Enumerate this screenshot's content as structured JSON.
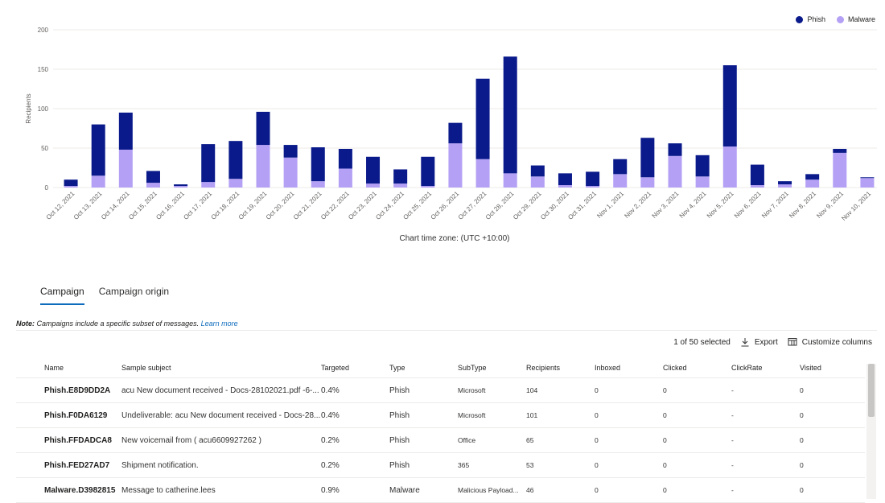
{
  "chart_data": {
    "type": "bar",
    "stacked": true,
    "categories": [
      "Oct 12, 2021",
      "Oct 13, 2021",
      "Oct 14, 2021",
      "Oct 15, 2021",
      "Oct 16, 2021",
      "Oct 17, 2021",
      "Oct 18, 2021",
      "Oct 19, 2021",
      "Oct 20, 2021",
      "Oct 21, 2021",
      "Oct 22, 2021",
      "Oct 23, 2021",
      "Oct 24, 2021",
      "Oct 25, 2021",
      "Oct 26, 2021",
      "Oct 27, 2021",
      "Oct 28, 2021",
      "Oct 29, 2021",
      "Oct 30, 2021",
      "Oct 31, 2021",
      "Nov 1, 2021",
      "Nov 2, 2021",
      "Nov 3, 2021",
      "Nov 4, 2021",
      "Nov 5, 2021",
      "Nov 6, 2021",
      "Nov 7, 2021",
      "Nov 8, 2021",
      "Nov 9, 2021",
      "Nov 10, 2021"
    ],
    "series": [
      {
        "name": "Malware",
        "color": "#b4a0f5",
        "values": [
          2,
          15,
          48,
          6,
          2,
          7,
          11,
          54,
          38,
          8,
          24,
          5,
          5,
          2,
          56,
          36,
          18,
          14,
          3,
          2,
          17,
          13,
          40,
          14,
          52,
          3,
          4,
          10,
          44,
          12
        ]
      },
      {
        "name": "Phish",
        "color": "#0a1a8a",
        "values": [
          8,
          65,
          47,
          15,
          2,
          48,
          48,
          42,
          16,
          43,
          25,
          34,
          18,
          37,
          26,
          102,
          148,
          14,
          15,
          18,
          19,
          50,
          16,
          27,
          103,
          26,
          4,
          7,
          5,
          1
        ]
      }
    ],
    "ylabel": "Recipients",
    "ylim": [
      0,
      200
    ],
    "yticks": [
      0,
      50,
      100,
      150,
      200
    ],
    "grid": true,
    "legend_position": "top-right"
  },
  "legend": {
    "phish": "Phish",
    "malware": "Malware",
    "phish_color": "#0a1a8a",
    "malware_color": "#b4a0f5"
  },
  "chart_footer": "Chart time zone: (UTC +10:00)",
  "tabs": [
    {
      "label": "Campaign"
    },
    {
      "label": "Campaign origin"
    }
  ],
  "note": {
    "label": "Note:",
    "text": " Campaigns include a specific subset of messages. ",
    "link": "Learn more"
  },
  "toolbar": {
    "selected": "1 of 50 selected",
    "export": "Export",
    "customize": "Customize columns"
  },
  "table": {
    "headers": {
      "name": "Name",
      "subject": "Sample subject",
      "targeted": "Targeted",
      "type": "Type",
      "subtype": "SubType",
      "recipients": "Recipients",
      "inboxed": "Inboxed",
      "clicked": "Clicked",
      "clickrate": "ClickRate",
      "visited": "Visited"
    },
    "rows": [
      {
        "name": "Phish.E8D9DD2A",
        "subject": "acu New document received - Docs-28102021.pdf -6-...",
        "targeted": "0.4%",
        "type": "Phish",
        "subtype": "Microsoft",
        "recipients": "104",
        "inboxed": "0",
        "clicked": "0",
        "clickrate": "-",
        "visited": "0"
      },
      {
        "name": "Phish.F0DA6129",
        "subject": "Undeliverable: acu New document received - Docs-28...",
        "targeted": "0.4%",
        "type": "Phish",
        "subtype": "Microsoft",
        "recipients": "101",
        "inboxed": "0",
        "clicked": "0",
        "clickrate": "-",
        "visited": "0"
      },
      {
        "name": "Phish.FFDADCA8",
        "subject": "New voicemail from ( acu6609927262 )",
        "targeted": "0.2%",
        "type": "Phish",
        "subtype": "Office",
        "recipients": "65",
        "inboxed": "0",
        "clicked": "0",
        "clickrate": "-",
        "visited": "0"
      },
      {
        "name": "Phish.FED27AD7",
        "subject": "Shipment notification.",
        "targeted": "0.2%",
        "type": "Phish",
        "subtype": "365",
        "recipients": "53",
        "inboxed": "0",
        "clicked": "0",
        "clickrate": "-",
        "visited": "0"
      },
      {
        "name": "Malware.D3982815",
        "subject": "Message to catherine.lees",
        "targeted": "0.9%",
        "type": "Malware",
        "subtype": "Malicious Payload...",
        "recipients": "46",
        "inboxed": "0",
        "clicked": "0",
        "clickrate": "-",
        "visited": "0"
      }
    ]
  }
}
